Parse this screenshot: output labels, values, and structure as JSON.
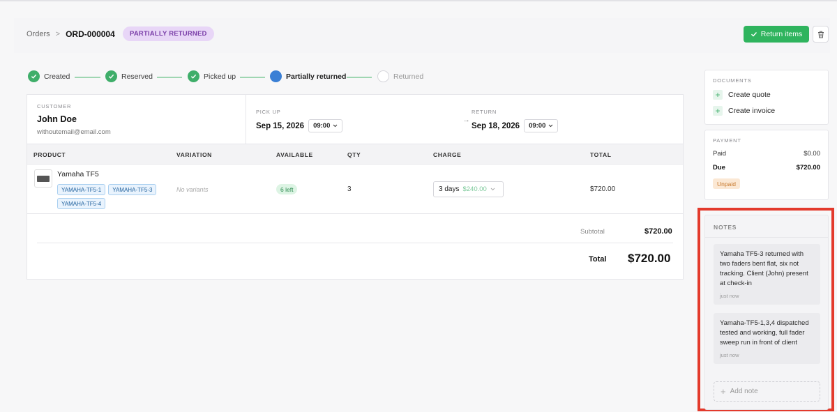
{
  "header": {
    "breadcrumb_root": "Orders",
    "breadcrumb_sep": ">",
    "order_id": "ORD-000004",
    "status_badge": "PARTIALLY RETURNED",
    "return_button": "Return items"
  },
  "steps": [
    {
      "label": "Created",
      "state": "done"
    },
    {
      "label": "Reserved",
      "state": "done"
    },
    {
      "label": "Picked up",
      "state": "done"
    },
    {
      "label": "Partially returned",
      "state": "current"
    },
    {
      "label": "Returned",
      "state": "pending"
    }
  ],
  "customer": {
    "caption": "CUSTOMER",
    "name": "John Doe",
    "email": "withoutemail@email.com"
  },
  "pickup": {
    "caption": "PICK UP",
    "date": "Sep 15, 2026",
    "time": "09:00"
  },
  "return": {
    "caption": "RETURN",
    "date": "Sep 18, 2026",
    "time": "09:00"
  },
  "table": {
    "headers": [
      "PRODUCT",
      "VARIATION",
      "AVAILABLE",
      "QTY",
      "CHARGE",
      "TOTAL"
    ],
    "row": {
      "product": "Yamaha TF5",
      "tags": [
        "YAMAHA-TF5-1",
        "YAMAHA-TF5-3",
        "YAMAHA-TF5-4"
      ],
      "variation": "No variants",
      "available": "6 left",
      "qty": "3",
      "charge_period": "3 days",
      "charge_price": "$240.00",
      "total": "$720.00"
    }
  },
  "summary": {
    "subtotal_label": "Subtotal",
    "subtotal": "$720.00",
    "total_label": "Total",
    "total": "$720.00"
  },
  "documents": {
    "title": "DOCUMENTS",
    "items": [
      "Create quote",
      "Create invoice"
    ]
  },
  "payment": {
    "title": "PAYMENT",
    "paid_label": "Paid",
    "paid": "$0.00",
    "due_label": "Due",
    "due": "$720.00",
    "status": "Unpaid"
  },
  "notes": {
    "title": "NOTES",
    "items": [
      {
        "text": "Yamaha TF5-3 returned with two faders bent flat, six not tracking. Client (John) present at check-in",
        "when": "just now"
      },
      {
        "text": "Yamaha-TF5-1,3,4 dispatched tested and working, full fader sweep run in front of client",
        "when": "just now"
      }
    ],
    "add_label": "Add note"
  },
  "colors": {
    "accent_green": "#2fb45e",
    "status_purple": "#7a3ea8",
    "current_step_blue": "#3a7fd5",
    "highlight_red": "#e33a2c"
  }
}
